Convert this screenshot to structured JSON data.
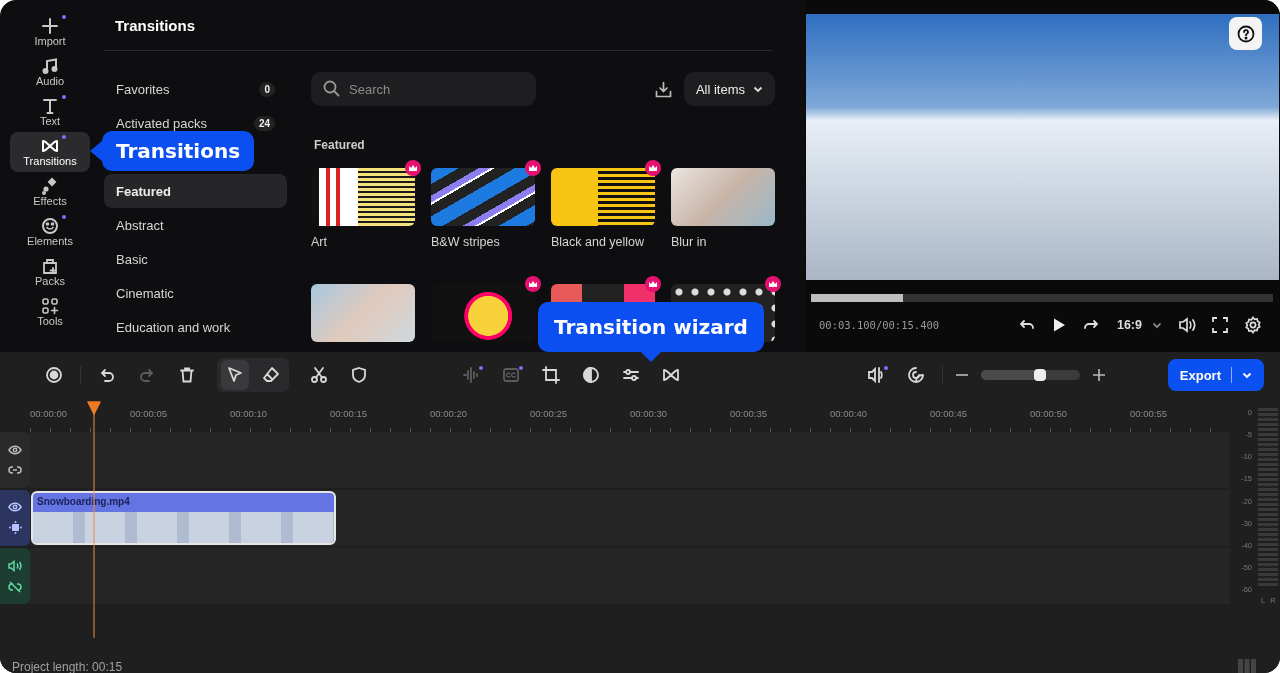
{
  "sidebar": {
    "items": [
      {
        "label": "Import",
        "new": true,
        "selected": false
      },
      {
        "label": "Audio",
        "new": false,
        "selected": false
      },
      {
        "label": "Text",
        "new": true,
        "selected": false
      },
      {
        "label": "Transitions",
        "new": true,
        "selected": true
      },
      {
        "label": "Effects",
        "new": false,
        "selected": false
      },
      {
        "label": "Elements",
        "new": true,
        "selected": false
      },
      {
        "label": "Packs",
        "new": false,
        "selected": false
      },
      {
        "label": "Tools",
        "new": false,
        "selected": false
      }
    ]
  },
  "sidebar_callout": "Transitions",
  "panel": {
    "title": "Transitions",
    "categories": [
      {
        "label": "Favorites",
        "count": "0",
        "selected": false
      },
      {
        "label": "Activated packs",
        "count": "24",
        "selected": false
      },
      {
        "label": "Featured",
        "selected": true
      },
      {
        "label": "Abstract",
        "selected": false
      },
      {
        "label": "Basic",
        "selected": false
      },
      {
        "label": "Cinematic",
        "selected": false
      },
      {
        "label": "Education and work",
        "selected": false
      }
    ]
  },
  "search": {
    "placeholder": "Search"
  },
  "filter": {
    "value": "All items"
  },
  "gallery": {
    "title": "Featured",
    "items": [
      {
        "label": "Art",
        "premium": true
      },
      {
        "label": "B&W stripes",
        "premium": true
      },
      {
        "label": "Black and yellow",
        "premium": true
      },
      {
        "label": "Blur in",
        "premium": false
      },
      {
        "premium": false
      },
      {
        "premium": true
      },
      {
        "premium": true
      },
      {
        "premium": true
      }
    ]
  },
  "wizard_callout": "Transition wizard",
  "preview": {
    "progress": {
      "level": 0.2
    },
    "time": "00:03.100/00:15.400",
    "aspect": "16:9"
  },
  "toolbar": {
    "left": [
      {
        "disabled": false
      },
      {
        "disabled": false
      },
      {
        "disabled": true
      },
      {
        "disabled": false
      }
    ],
    "modes": [
      {
        "selected": true
      },
      {
        "selected": false
      }
    ],
    "edit": [
      {
        "disabled": false,
        "new": false
      },
      {
        "disabled": false,
        "new": false
      },
      {
        "disabled": true,
        "new": true
      },
      {
        "disabled": true,
        "new": true
      },
      {
        "disabled": false,
        "new": false
      },
      {
        "disabled": false,
        "new": false
      },
      {
        "disabled": false,
        "new": false
      },
      {
        "disabled": false,
        "new": false
      }
    ],
    "right": [
      {
        "new": true
      },
      {
        "new": false
      }
    ],
    "zoom": {
      "level": 0.6
    },
    "export": {
      "label": "Export"
    }
  },
  "timeline": {
    "ruler": [
      "00:00:00",
      "00:00:05",
      "00:00:10",
      "00:00:15",
      "00:00:20",
      "00:00:25",
      "00:00:30",
      "00:00:35",
      "00:00:40",
      "00:00:45",
      "00:00:50",
      "00:00:55"
    ],
    "playhead": {
      "level": 0.053
    }
  },
  "tracks": [
    {
      "kind": "overlay"
    },
    {
      "kind": "video",
      "clip": {
        "label": "Snowboarding.mp4"
      }
    },
    {
      "kind": "audio"
    }
  ],
  "meter": {
    "scale": [
      "0",
      "-5",
      "-10",
      "-15",
      "-20",
      "-30",
      "-40",
      "-50",
      "-60"
    ],
    "channels": [
      "L",
      "R"
    ]
  },
  "status": {
    "project_length": "Project length: 00:15"
  }
}
